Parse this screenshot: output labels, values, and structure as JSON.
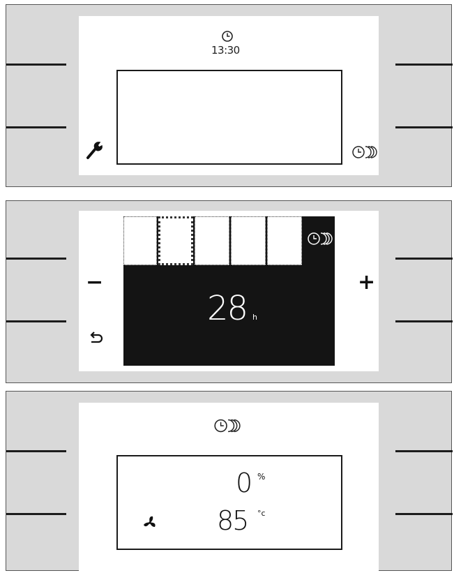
{
  "panels": [
    {
      "name": "main-screen",
      "clock_icon": "clock-icon",
      "time": "13:30",
      "left_icon": "wrench-icon",
      "right_icon": "program-cycle-icon"
    },
    {
      "name": "time-setting-screen",
      "minus_label": "−",
      "plus_label": "+",
      "back_icon": "back-arrow-icon",
      "value": "28",
      "unit": "h",
      "header_icon": "program-cycle-icon",
      "slot_count": 5
    },
    {
      "name": "status-screen",
      "header_icon": "program-cycle-icon",
      "percent_value": "0",
      "percent_unit": "%",
      "temp_value": "85",
      "temp_unit": "°c",
      "fan_icon": "fan-icon"
    }
  ],
  "colors": {
    "panel_bg": "#d9d9d9",
    "screen_bg": "#ffffff",
    "dark_fill": "#141414",
    "line": "#1c1c1c"
  }
}
